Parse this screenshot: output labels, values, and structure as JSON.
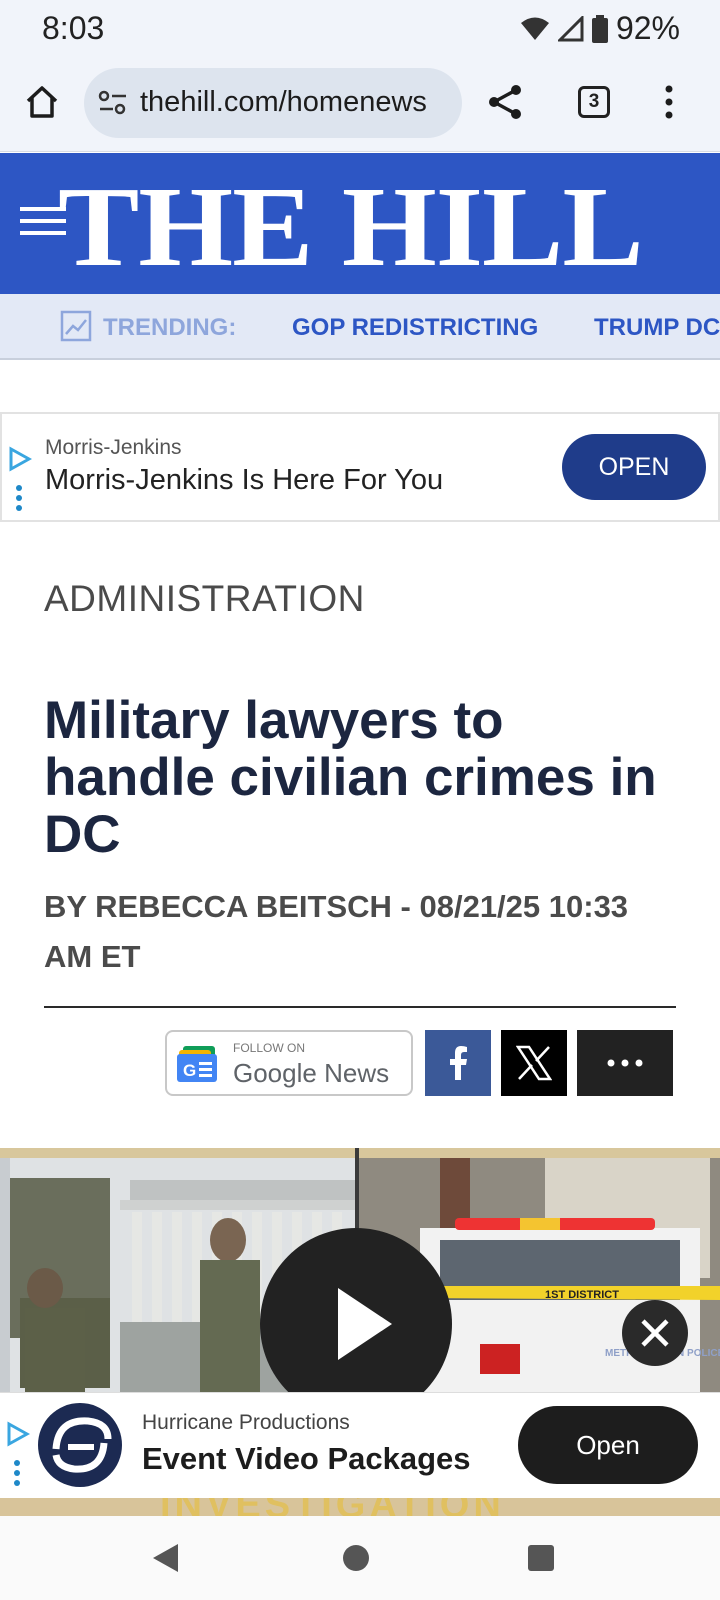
{
  "status_bar": {
    "time": "8:03",
    "battery": "92%"
  },
  "browser": {
    "url": "thehill.com/homenews",
    "tab_count": "3"
  },
  "site": {
    "logo": "THE HILL"
  },
  "trending": {
    "label": "TRENDING:",
    "items": [
      "GOP REDISTRICTING",
      "TRUMP DC"
    ]
  },
  "top_ad": {
    "brand": "Morris-Jenkins",
    "headline": "Morris-Jenkins Is Here For You",
    "button": "OPEN"
  },
  "article": {
    "section": "ADMINISTRATION",
    "headline": "Military lawyers to handle civilian crimes in DC",
    "byline": "BY REBECCA BEITSCH - 08/21/25 10:33 AM ET"
  },
  "follow": {
    "small": "FOLLOW ON",
    "google": "Google",
    "news": "News"
  },
  "hero_text": {
    "district": "1ST DISTRICT",
    "police": "METROPOLITAN POLICE"
  },
  "bottom_ad": {
    "brand": "Hurricane Productions",
    "headline": "Event Video Packages",
    "button": "Open"
  },
  "peek_text": "INVESTIGATION",
  "colors": {
    "brand_blue": "#2d56c4",
    "ad_button": "#1f3c8a",
    "headline": "#1c2640"
  }
}
